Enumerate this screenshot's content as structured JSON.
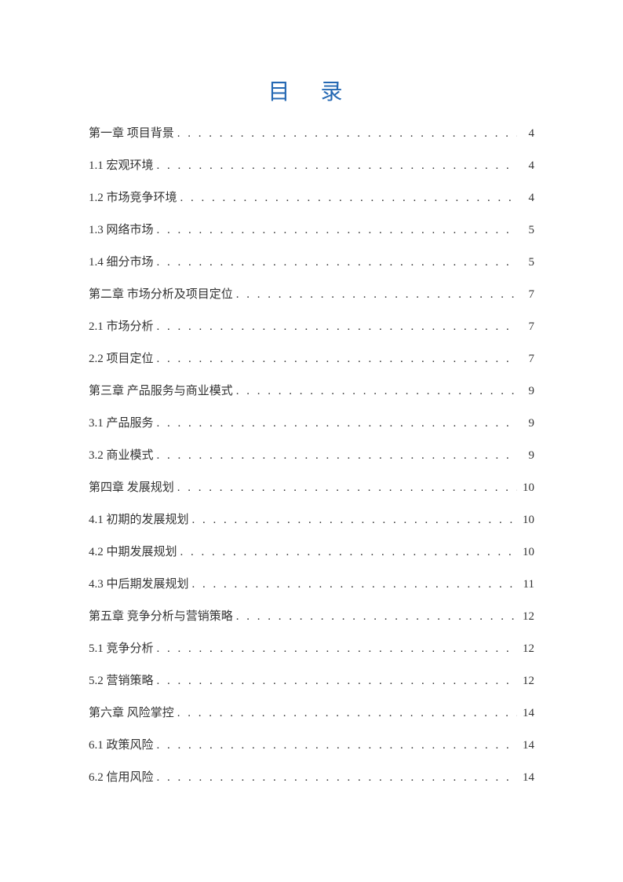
{
  "title": "目 录",
  "entries": [
    {
      "label": "第一章 项目背景",
      "page": "4"
    },
    {
      "label": "1.1 宏观环境",
      "page": "4"
    },
    {
      "label": "1.2 市场竞争环境",
      "page": "4"
    },
    {
      "label": "1.3 网络市场",
      "page": "5"
    },
    {
      "label": "1.4 细分市场",
      "page": "5"
    },
    {
      "label": "第二章 市场分析及项目定位",
      "page": "7"
    },
    {
      "label": "2.1 市场分析",
      "page": "7"
    },
    {
      "label": "2.2 项目定位",
      "page": "7"
    },
    {
      "label": "第三章 产品服务与商业模式",
      "page": "9"
    },
    {
      "label": "3.1 产品服务",
      "page": "9"
    },
    {
      "label": "3.2 商业模式",
      "page": "9"
    },
    {
      "label": "第四章 发展规划",
      "page": "10"
    },
    {
      "label": "4.1 初期的发展规划",
      "page": "10"
    },
    {
      "label": "4.2 中期发展规划",
      "page": "10"
    },
    {
      "label": "4.3 中后期发展规划",
      "page": "11"
    },
    {
      "label": "第五章 竞争分析与营销策略",
      "page": "12"
    },
    {
      "label": "5.1 竞争分析",
      "page": "12"
    },
    {
      "label": "5.2 营销策略",
      "page": "12"
    },
    {
      "label": "第六章 风险掌控",
      "page": "14"
    },
    {
      "label": "6.1 政策风险",
      "page": "14"
    },
    {
      "label": "6.2 信用风险",
      "page": "14"
    }
  ]
}
